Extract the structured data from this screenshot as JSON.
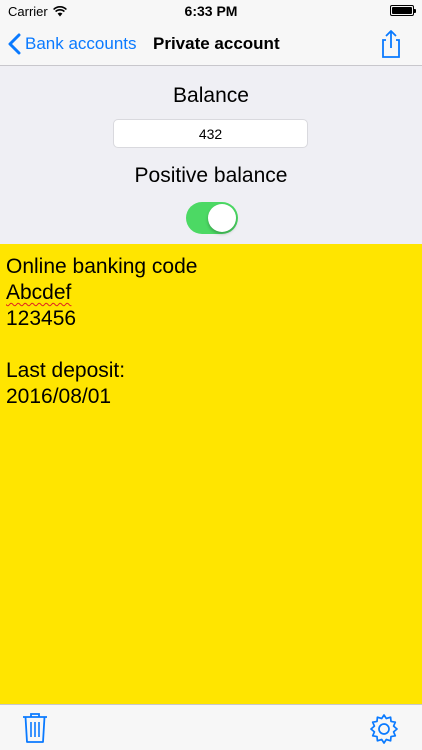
{
  "status_bar": {
    "carrier": "Carrier",
    "time": "6:33 PM"
  },
  "nav": {
    "back_label": "Bank accounts",
    "title": "Private account"
  },
  "form": {
    "balance_label": "Balance",
    "balance_value": "432",
    "positive_label": "Positive balance",
    "positive_on": true
  },
  "notes": {
    "lines": [
      "Online banking code",
      "Abcdef",
      "123456",
      "",
      "Last deposit:",
      "2016/08/01"
    ]
  },
  "colors": {
    "accent": "#0a7aff",
    "toggle_on": "#4cd964",
    "notes_background": "#ffe500"
  },
  "icons": {
    "back": "chevron-left-icon",
    "share": "share-icon",
    "trash": "trash-icon",
    "settings": "gear-icon",
    "wifi": "wifi-icon",
    "battery": "battery-icon"
  }
}
